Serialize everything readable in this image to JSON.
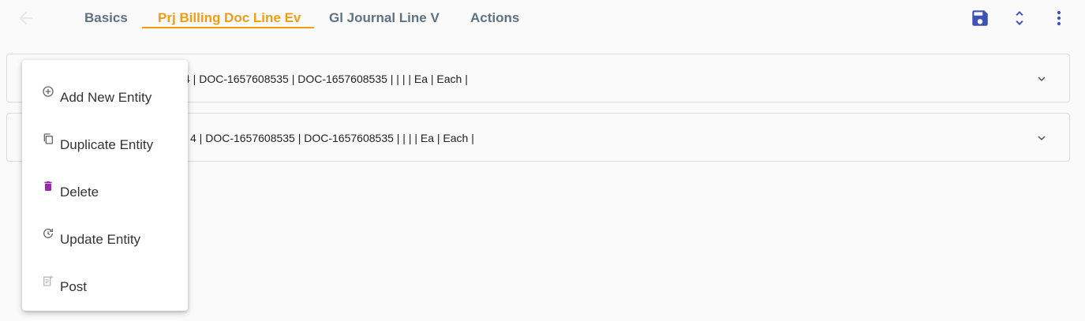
{
  "header": {
    "tabs": [
      {
        "label": "Basics"
      },
      {
        "label": "Prj Billing Doc Line Ev",
        "active": true
      },
      {
        "label": "Gl Journal Line V"
      },
      {
        "label": "Actions"
      }
    ],
    "icons": {
      "back": "arrow-left-icon",
      "save": "save-icon",
      "expand": "unfold-icon",
      "more": "more-vert-icon"
    },
    "colors": {
      "accent": "#f39c12",
      "primary": "#3f51b5",
      "tab_text": "#5f7282"
    }
  },
  "rows": [
    {
      "text": "4 | DOC-1657608535 | DOC-1657608535 |  |  |  | Ea | Each |"
    },
    {
      "text": "4 | DOC-1657608535 | DOC-1657608535 |  |  |  | Ea | Each |"
    }
  ],
  "menu": {
    "items": [
      {
        "label": "Add New Entity",
        "icon": "add-circle-icon"
      },
      {
        "label": "Duplicate Entity",
        "icon": "copy-icon"
      },
      {
        "label": "Delete",
        "icon": "trash-icon",
        "icon_color": "#9c27b0"
      },
      {
        "label": "Update Entity",
        "icon": "update-icon"
      },
      {
        "label": "Post",
        "icon": "post-icon"
      }
    ]
  }
}
